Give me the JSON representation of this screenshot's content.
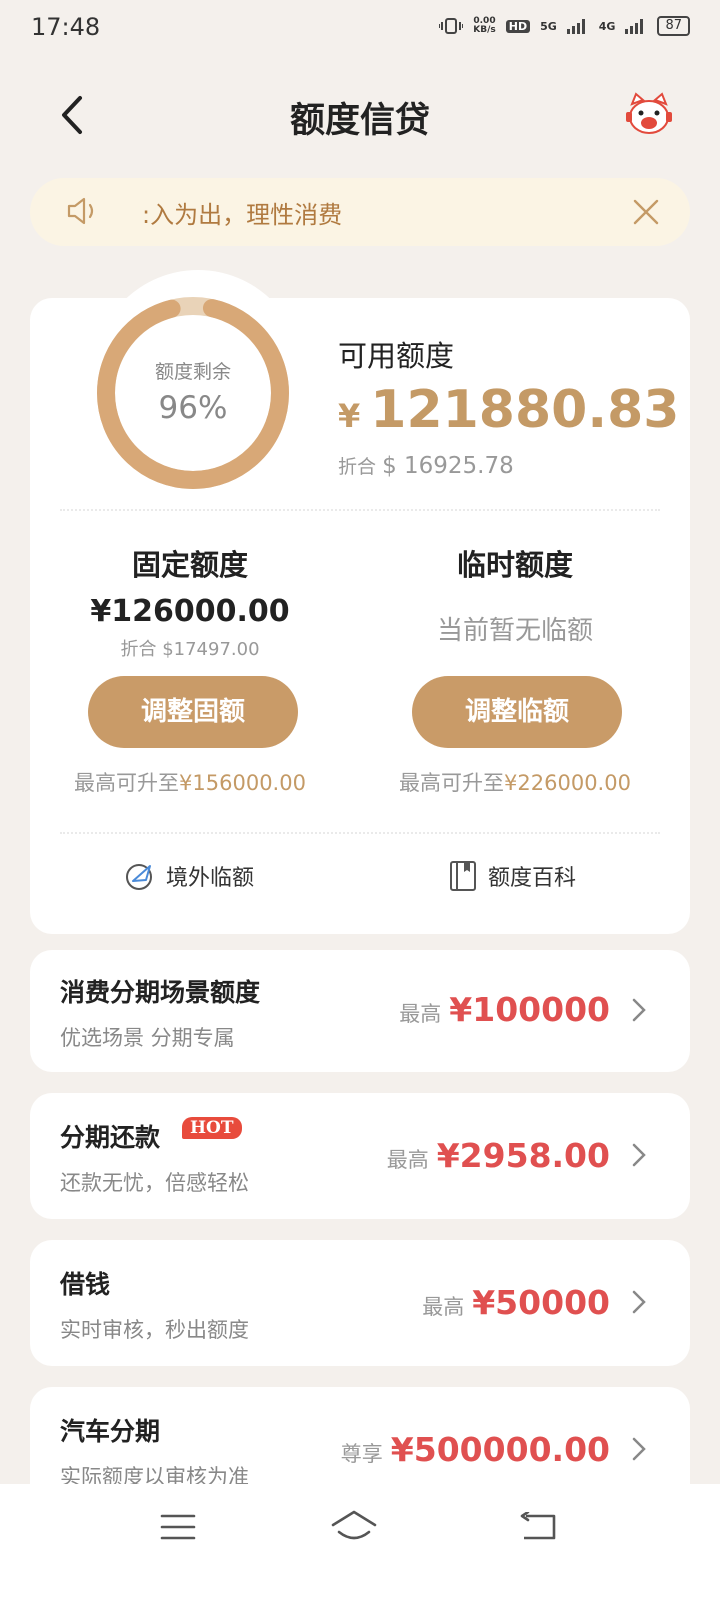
{
  "status_bar": {
    "time": "17:48",
    "net_speed_value": "0.00",
    "net_speed_unit": "KB/s",
    "hd_label": "HD",
    "signal1": "5G",
    "signal2": "4G",
    "battery": "87"
  },
  "header": {
    "title": "额度信贷",
    "back_icon": "chevron-left-icon",
    "mascot_icon": "cat-mascot-icon"
  },
  "notice": {
    "text": ":入为出，理性消费",
    "icon": "speaker-icon",
    "close_icon": "close-icon"
  },
  "credit": {
    "ring_label": "额度剩余",
    "ring_value": "96%",
    "ring_fraction": 0.96,
    "available_label": "可用额度",
    "available_currency": "¥",
    "available_amount": "121880.83",
    "conv_prefix": "折合",
    "conv_value": "$ 16925.78"
  },
  "fixed": {
    "title": "固定额度",
    "amount": "¥126000.00",
    "conv": "折合 $17497.00",
    "button": "调整固额",
    "max_prefix": "最高可升至",
    "max_value": "¥156000.00"
  },
  "temp": {
    "title": "临时额度",
    "none_text": "当前暂无临额",
    "button": "调整临额",
    "max_prefix": "最高可升至",
    "max_value": "¥226000.00"
  },
  "links": [
    {
      "label": "境外临额",
      "icon": "plane-globe-icon"
    },
    {
      "label": "额度百科",
      "icon": "book-icon"
    }
  ],
  "products": [
    {
      "title": "消费分期场景额度",
      "sub": "优选场景 分期专属",
      "prefix": "最高",
      "value": "¥100000"
    },
    {
      "title": "分期还款",
      "badge": "HOT",
      "sub": "还款无忧，倍感轻松",
      "prefix": "最高",
      "value": "¥2958.00"
    },
    {
      "title": "借钱",
      "sub": "实时审核，秒出额度",
      "prefix": "最高",
      "value": "¥50000"
    },
    {
      "title": "汽车分期",
      "sub": "实际额度以审核为准",
      "prefix": "尊享",
      "value": "¥500000.00"
    }
  ],
  "nav": {
    "menu_icon": "menu-icon",
    "home_icon": "home-icon",
    "back_icon": "back-icon"
  },
  "colors": {
    "accent": "#c99b68",
    "price_red": "#e05050",
    "notice_bg": "#fbf4e4",
    "page_bg": "#f4f0ec"
  }
}
